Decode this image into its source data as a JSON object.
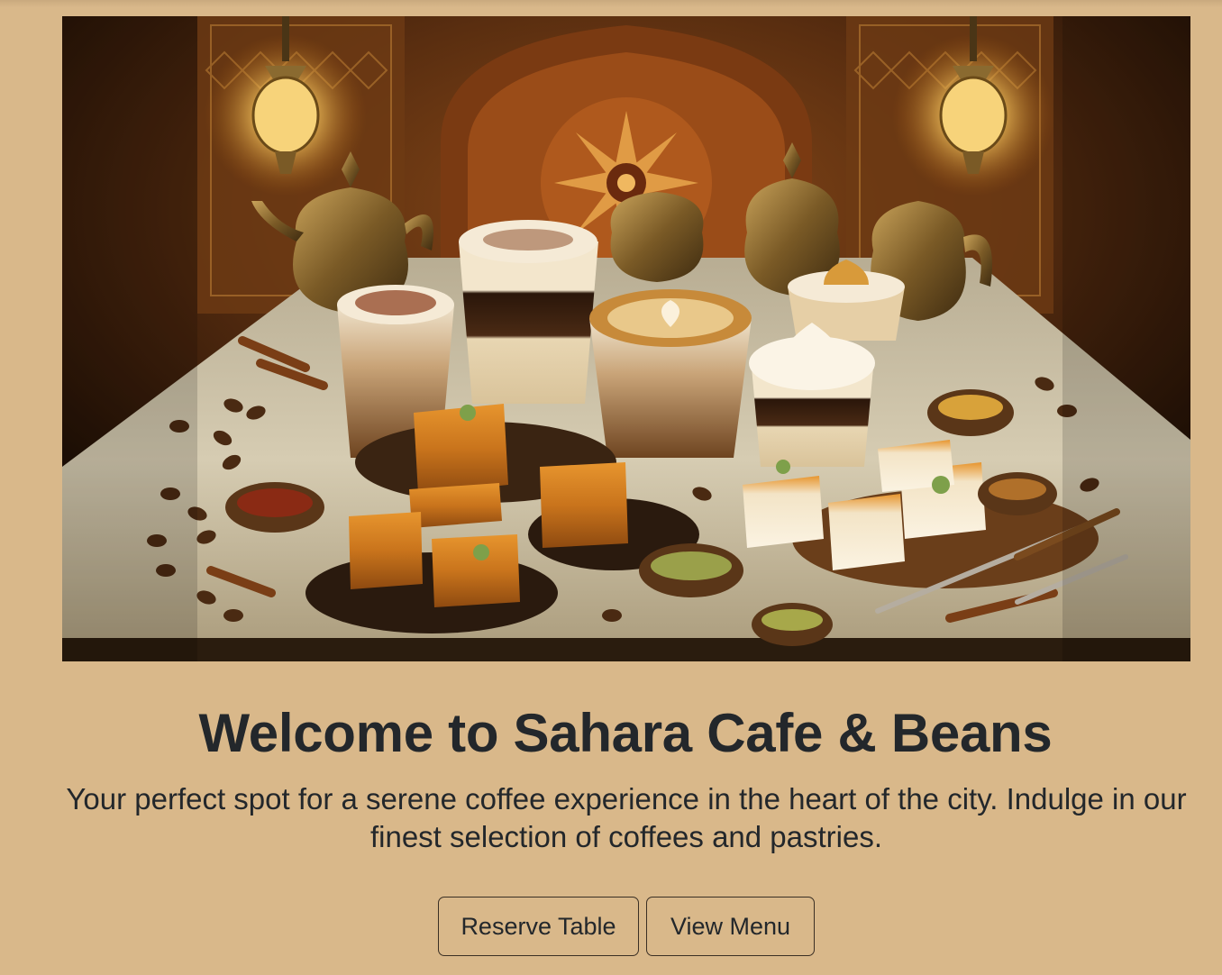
{
  "hero": {
    "image_alt": "Arabic coffee drinks and baklava pastries on a table with brass teapots and lanterns",
    "title": "Welcome to Sahara Cafe & Beans",
    "subtitle": "Your perfect spot for a serene coffee experience in the heart of the city. Indulge in our finest selection of coffees and pastries.",
    "buttons": {
      "reserve_label": "Reserve Table",
      "menu_label": "View Menu"
    }
  },
  "colors": {
    "page_background": "#d9b88a",
    "text": "#23272b",
    "button_border": "#3a2f24"
  }
}
